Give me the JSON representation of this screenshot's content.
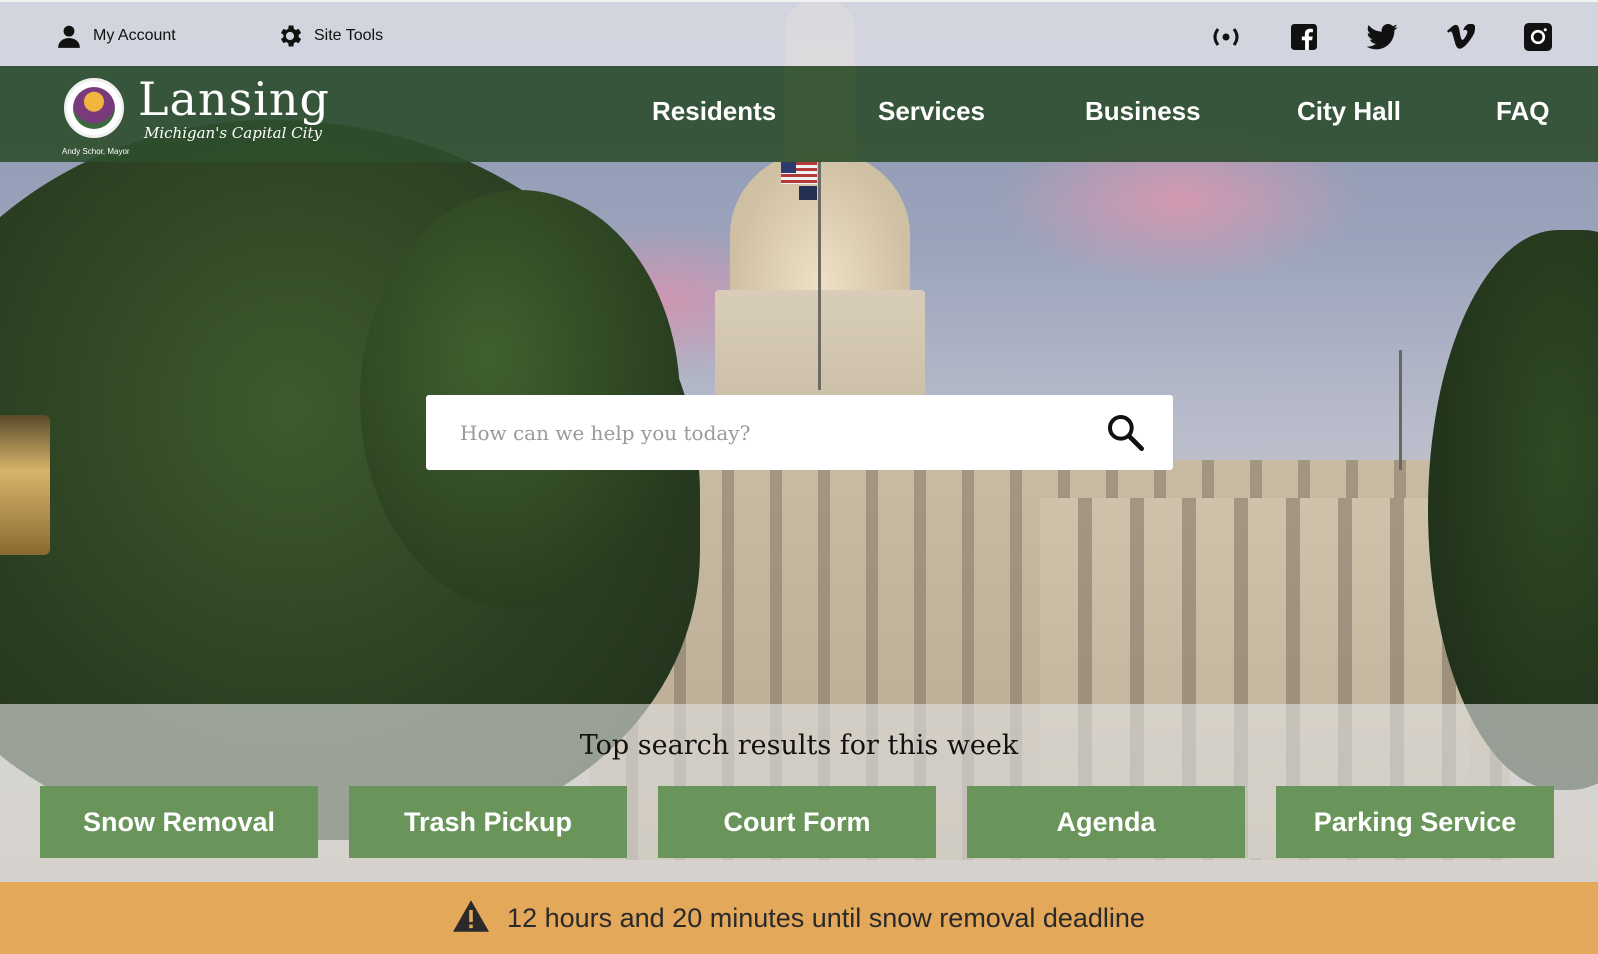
{
  "topbar": {
    "account_label": "My Account",
    "tools_label": "Site Tools",
    "social": [
      "broadcast-icon",
      "facebook-icon",
      "twitter-icon",
      "vimeo-icon",
      "instagram-icon"
    ]
  },
  "logo": {
    "wordmark": "Lansing",
    "tagline": "Michigan's Capital City",
    "mayor": "Andy Schor, Mayor"
  },
  "nav": {
    "items": [
      {
        "label": "Residents"
      },
      {
        "label": "Services"
      },
      {
        "label": "Business"
      },
      {
        "label": "City Hall"
      },
      {
        "label": "FAQ"
      }
    ]
  },
  "search": {
    "placeholder": "How can we help you today?",
    "value": ""
  },
  "top_results": {
    "title": "Top search results for this week",
    "buttons": [
      {
        "label": "Snow Removal"
      },
      {
        "label": "Trash Pickup"
      },
      {
        "label": "Court Form"
      },
      {
        "label": "Agenda"
      },
      {
        "label": "Parking Service"
      }
    ]
  },
  "alert": {
    "message": "12 hours and 20 minutes until snow removal deadline",
    "color": "#e3a85a"
  },
  "colors": {
    "nav_green": "#2e4e2c",
    "button_green": "#6a955a"
  }
}
